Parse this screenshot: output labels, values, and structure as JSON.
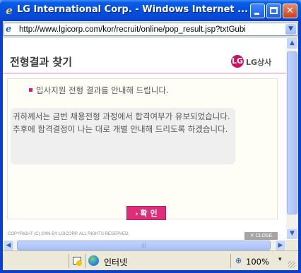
{
  "window": {
    "title": "LG International Corp. - Windows Internet ...",
    "controls": {
      "minimize": "minimize",
      "maximize": "maximize",
      "close": "✕"
    }
  },
  "addressbar": {
    "url": "http://www.lgicorp.com/kor/recruit/online/pop_result.jsp?txtGubi"
  },
  "page": {
    "title": "전형결과 찾기",
    "logo_mark": "LG",
    "logo_text": "LG상사",
    "notice": "입사지원 전형 결과를 안내해 드립니다.",
    "message_lines": [
      "귀하께서는 금번 채용전형 과정에서 합격여부가 유보되었습니다.",
      "추후에 합격결정이 나는 대로 개별 안내해 드리도록 하겠습니다."
    ],
    "confirm_label": "확 인",
    "confirm_chevron": "›",
    "copyright": "COPYRIGHT (C) 2006 BY LGICORP.  ALL RIGHTS RESERVED.",
    "close_label": "✕ CLOSE"
  },
  "statusbar": {
    "zone": "인터넷",
    "zoom": "100%",
    "zoom_dropdown": "▾"
  },
  "colors": {
    "accent": "#de2e78",
    "logo": "#c8125f",
    "titlebar": "#0050e0"
  }
}
